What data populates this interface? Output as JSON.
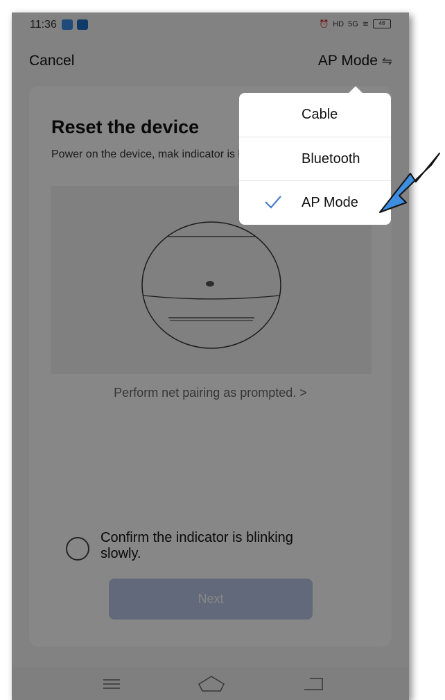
{
  "status_bar": {
    "time": "11:36",
    "battery": "48",
    "network": "5G",
    "hd_label": "HD"
  },
  "nav": {
    "cancel_label": "Cancel",
    "mode_label": "AP Mode",
    "mode_icon": "swap-arrows-icon"
  },
  "main": {
    "title": "Reset the device",
    "description": "Power on the device, mak indicator is blinking slowly",
    "help_link": "Perform net pairing as prompted. >",
    "confirm_text": "Confirm the indicator is blinking slowly.",
    "next_label": "Next"
  },
  "mode_menu": {
    "items": [
      {
        "label": "Cable",
        "selected": false
      },
      {
        "label": "Bluetooth",
        "selected": false
      },
      {
        "label": "AP Mode",
        "selected": true
      }
    ]
  },
  "colors": {
    "accent": "#4a7bd0",
    "next_disabled": "#b9c6e6",
    "annotation_arrow": "#3d8ee0"
  }
}
